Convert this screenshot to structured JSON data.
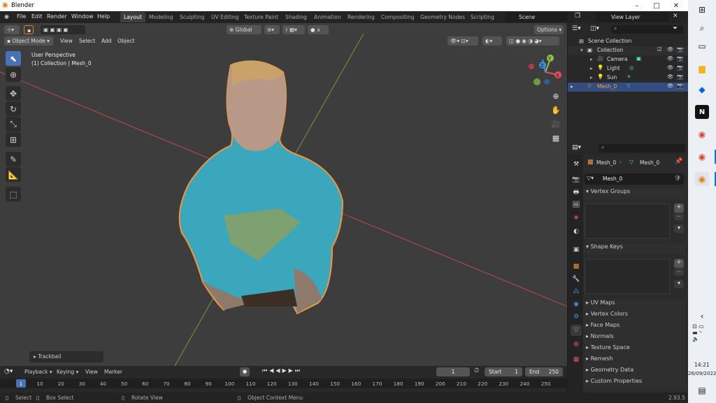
{
  "window": {
    "title": "Blender",
    "minimize": "–",
    "maximize": "□",
    "close": "✕"
  },
  "menubar": {
    "menus": [
      "File",
      "Edit",
      "Render",
      "Window",
      "Help"
    ],
    "workspaces": [
      "Layout",
      "Modeling",
      "Sculpting",
      "UV Editing",
      "Texture Paint",
      "Shading",
      "Animation",
      "Rendering",
      "Compositing",
      "Geometry Nodes",
      "Scripting"
    ],
    "scene": "Scene",
    "view_layer": "View Layer"
  },
  "viewport": {
    "transform_orientation": "Global",
    "mode": "Object Mode",
    "menus": [
      "View",
      "Select",
      "Add",
      "Object"
    ],
    "options": "Options",
    "perspective": "User Perspective",
    "collection_info": "(1) Collection | Mesh_0",
    "trackball": "Trackball",
    "gizmo": {
      "x": "X",
      "y": "Y",
      "z": "Z"
    }
  },
  "timeline": {
    "menus": [
      "Playback",
      "Keying",
      "View",
      "Marker"
    ],
    "current_frame": "1",
    "start_label": "Start",
    "start": "1",
    "end_label": "End",
    "end": "250",
    "ticks": [
      "1",
      "10",
      "20",
      "30",
      "40",
      "50",
      "60",
      "70",
      "80",
      "90",
      "100",
      "110",
      "120",
      "130",
      "140",
      "150",
      "160",
      "170",
      "180",
      "190",
      "200",
      "210",
      "220",
      "230",
      "240",
      "250"
    ]
  },
  "status": {
    "select": "Select",
    "box_select": "Box Select",
    "rotate": "Rotate View",
    "context_menu": "Object Context Menu",
    "version": "2.93.5"
  },
  "outliner": {
    "root": "Scene Collection",
    "collection": "Collection",
    "items": [
      "Camera",
      "Light",
      "Sun",
      "Mesh_0"
    ]
  },
  "properties": {
    "object": "Mesh_0",
    "data": "Mesh_0",
    "mesh_name": "Mesh_0",
    "panels": [
      "Vertex Groups",
      "Shape Keys",
      "UV Maps",
      "Vertex Colors",
      "Face Maps",
      "Normals",
      "Texture Space",
      "Remesh",
      "Geometry Data",
      "Custom Properties"
    ]
  },
  "taskbar": {
    "time": "14:21",
    "date": "26/09/2022"
  },
  "colors": {
    "accent": "#4772b3",
    "selected_outline": "#f4953a",
    "axis_x": "#e44d5e",
    "axis_y": "#8ac346",
    "axis_z": "#3d8fe0"
  }
}
